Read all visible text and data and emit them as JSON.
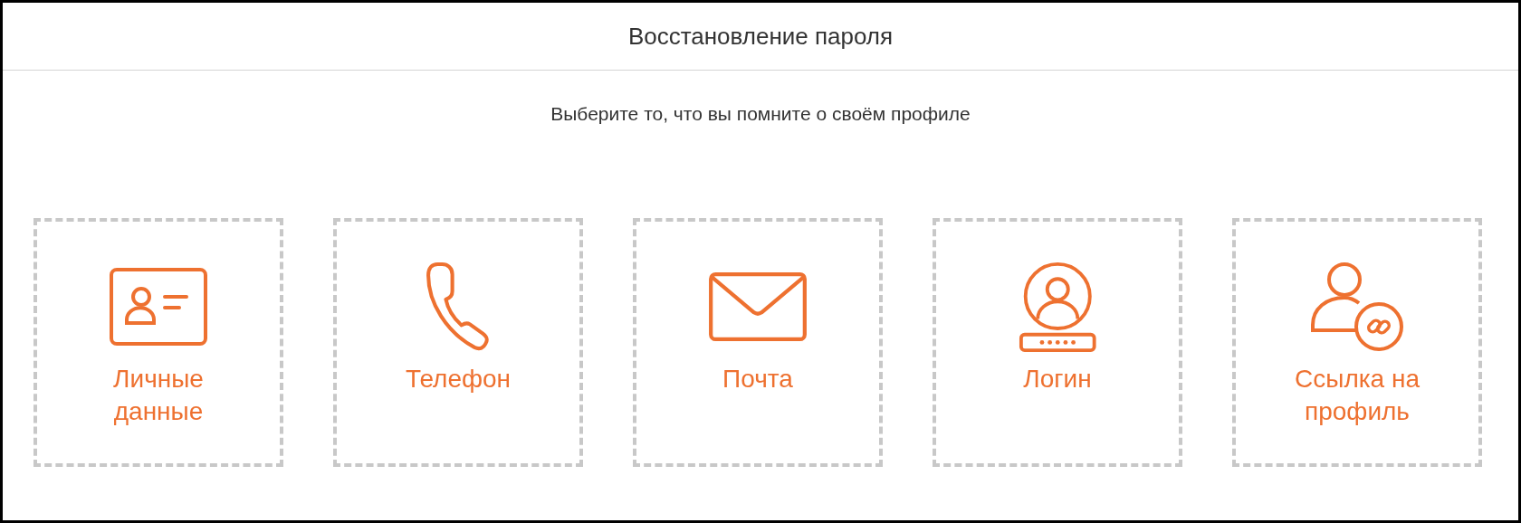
{
  "header": {
    "title": "Восстановление пароля"
  },
  "prompt": "Выберите то, что вы помните о своём профиле",
  "options": [
    {
      "kind": "card",
      "label": "Личные данные"
    },
    {
      "kind": "phone",
      "label": "Телефон"
    },
    {
      "kind": "mail",
      "label": "Почта"
    },
    {
      "kind": "login",
      "label": "Логин"
    },
    {
      "kind": "link",
      "label": "Ссылка на профиль"
    }
  ]
}
